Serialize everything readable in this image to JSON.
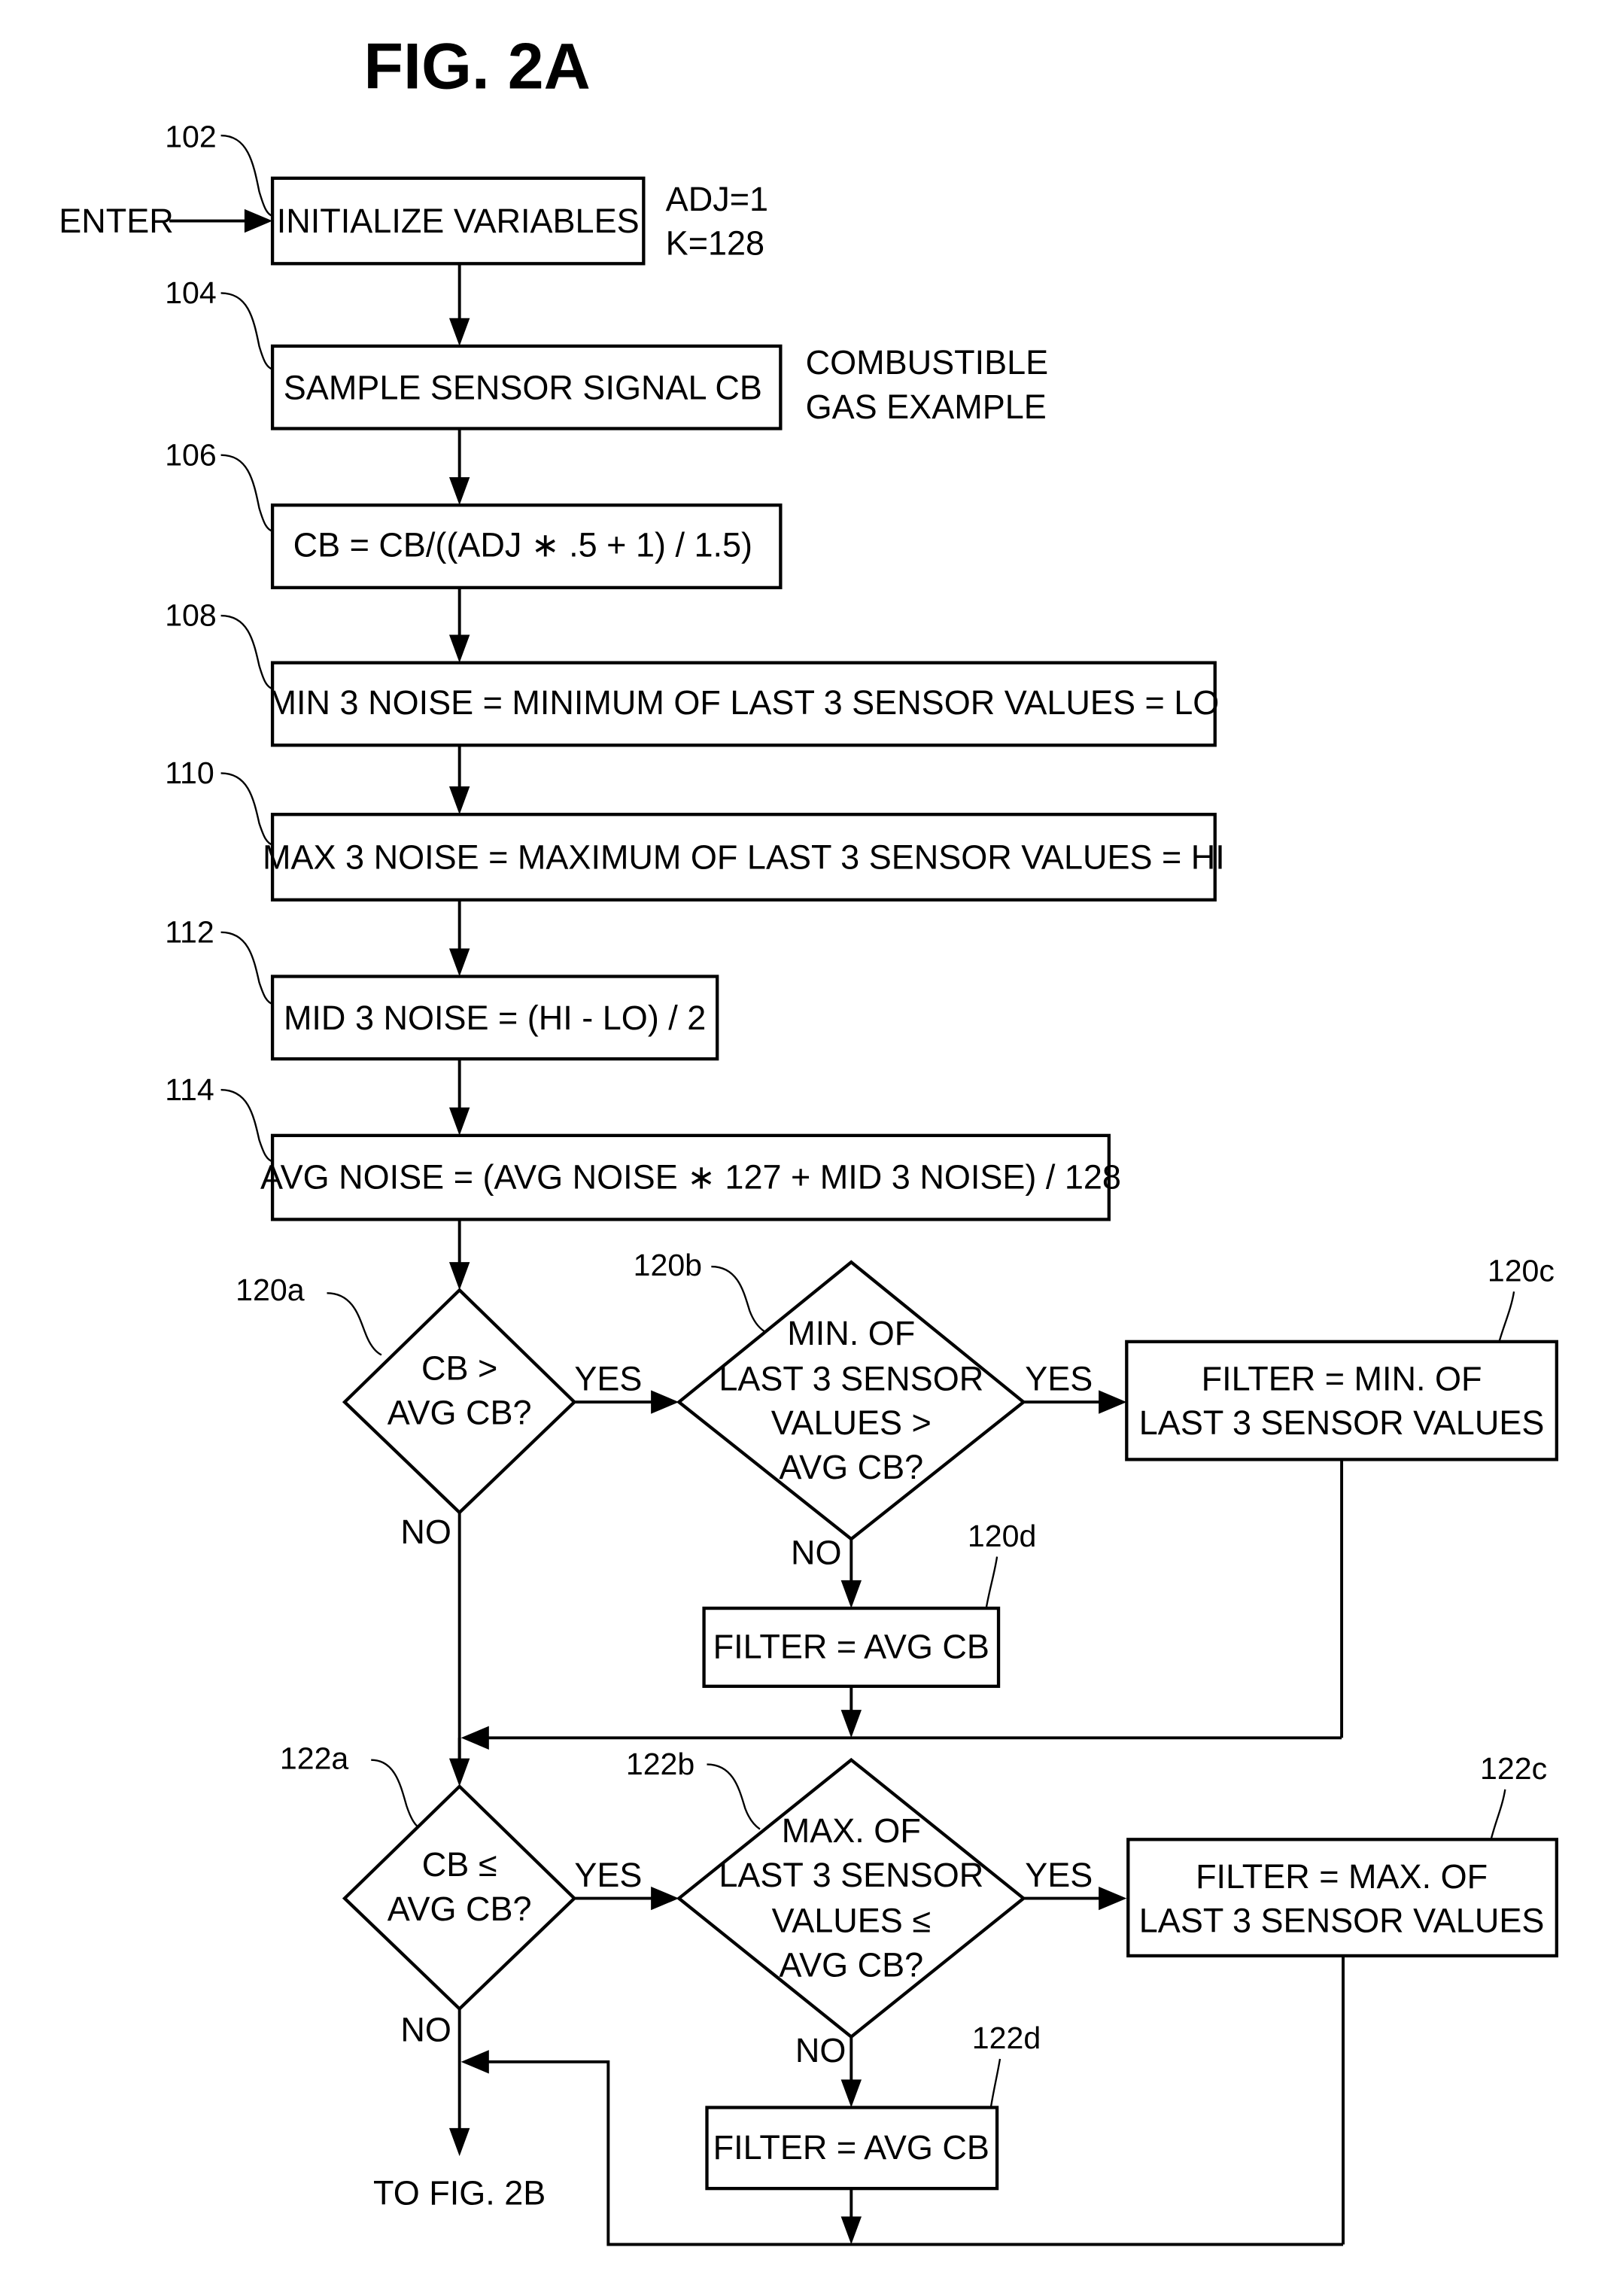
{
  "figure": {
    "title": "FIG. 2A",
    "entry_label": "ENTER",
    "exit_label": "TO FIG. 2B",
    "annotations": {
      "init_params": [
        "ADJ=1",
        "K=128"
      ],
      "sensor_example": [
        "COMBUSTIBLE",
        "GAS EXAMPLE"
      ]
    },
    "steps": [
      {
        "ref": "102",
        "type": "process",
        "lines": [
          "INITIALIZE VARIABLES"
        ]
      },
      {
        "ref": "104",
        "type": "process",
        "lines": [
          "SAMPLE SENSOR SIGNAL  CB"
        ]
      },
      {
        "ref": "106",
        "type": "process",
        "lines": [
          "CB = CB/((ADJ ∗ .5 + 1) / 1.5)"
        ]
      },
      {
        "ref": "108",
        "type": "process",
        "lines": [
          "MIN 3 NOISE = MINIMUM OF LAST 3 SENSOR VALUES = LO"
        ]
      },
      {
        "ref": "110",
        "type": "process",
        "lines": [
          "MAX 3 NOISE = MAXIMUM OF LAST 3 SENSOR VALUES = HI"
        ]
      },
      {
        "ref": "112",
        "type": "process",
        "lines": [
          "MID 3 NOISE = (HI - LO) / 2"
        ]
      },
      {
        "ref": "114",
        "type": "process",
        "lines": [
          "AVG NOISE = (AVG NOISE ∗ 127 + MID 3 NOISE) / 128"
        ]
      },
      {
        "ref": "120a",
        "type": "decision",
        "lines": [
          "CB >",
          "AVG CB?"
        ]
      },
      {
        "ref": "120b",
        "type": "decision",
        "lines": [
          "MIN. OF",
          "LAST 3 SENSOR",
          "VALUES >",
          "AVG CB?"
        ]
      },
      {
        "ref": "120c",
        "type": "process",
        "lines": [
          "FILTER = MIN. OF",
          "LAST 3 SENSOR VALUES"
        ]
      },
      {
        "ref": "120d",
        "type": "process",
        "lines": [
          "FILTER = AVG CB"
        ]
      },
      {
        "ref": "122a",
        "type": "decision",
        "lines": [
          "CB ≤",
          "AVG CB?"
        ]
      },
      {
        "ref": "122b",
        "type": "decision",
        "lines": [
          "MAX. OF",
          "LAST 3 SENSOR",
          "VALUES ≤",
          "AVG CB?"
        ]
      },
      {
        "ref": "122c",
        "type": "process",
        "lines": [
          "FILTER = MAX. OF",
          "LAST 3 SENSOR VALUES"
        ]
      },
      {
        "ref": "122d",
        "type": "process",
        "lines": [
          "FILTER = AVG CB"
        ]
      }
    ],
    "branch_labels": {
      "yes": "YES",
      "no": "NO"
    }
  }
}
